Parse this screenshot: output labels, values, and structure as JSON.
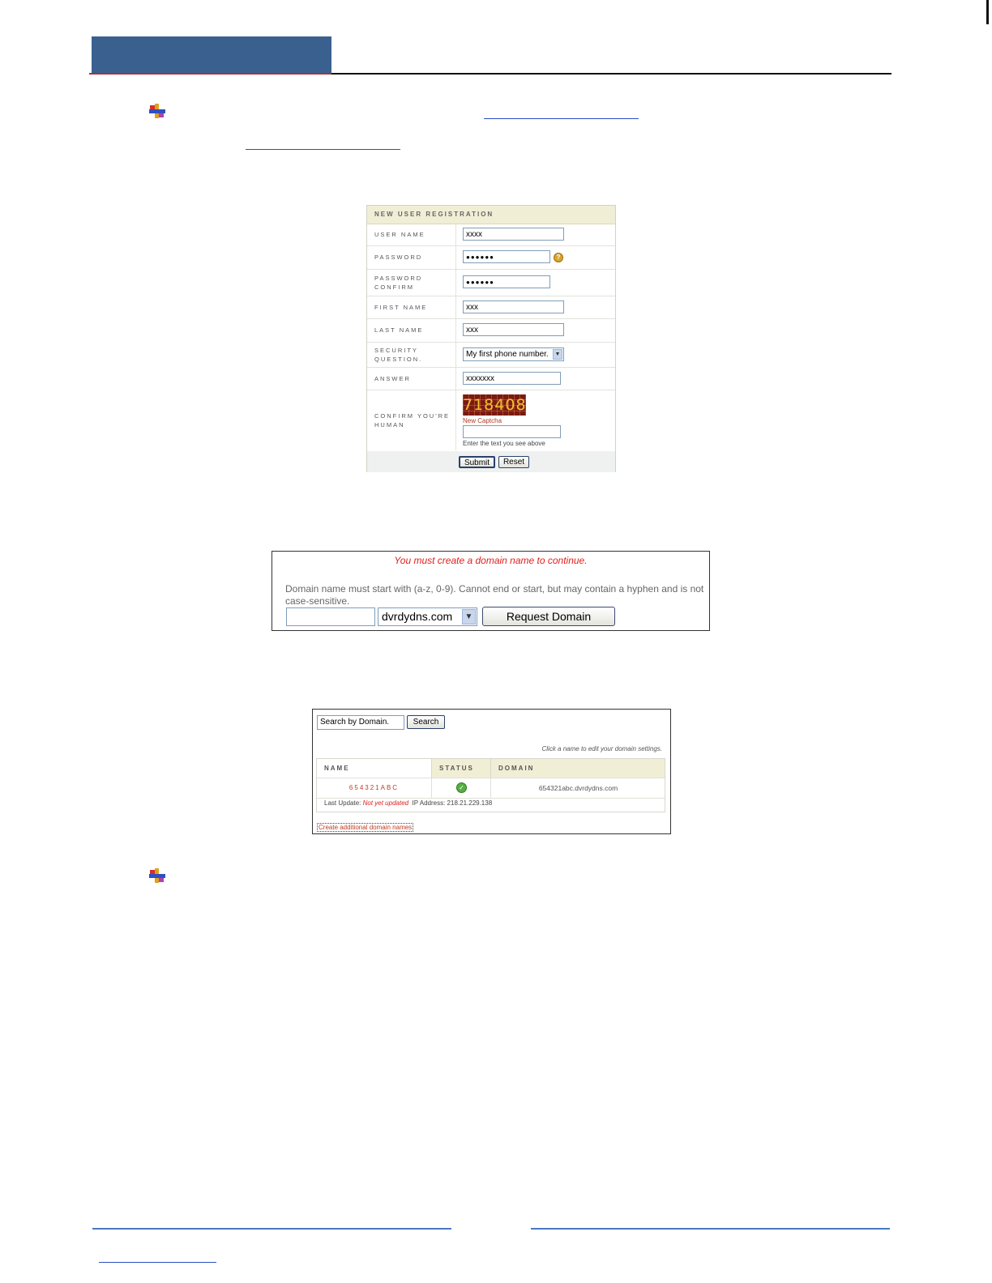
{
  "registration": {
    "title": "NEW USER REGISTRATION",
    "fields": {
      "user_name": {
        "label": "USER NAME",
        "value": "xxxx"
      },
      "password": {
        "label": "PASSWORD",
        "value": "●●●●●●"
      },
      "password_confirm": {
        "label_line1": "PASSWORD",
        "label_line2": "CONFIRM",
        "value": "●●●●●●"
      },
      "first_name": {
        "label": "FIRST NAME",
        "value": "xxx"
      },
      "last_name": {
        "label": "LAST NAME",
        "value": "xxx"
      },
      "security_question": {
        "label_line1": "SECURITY",
        "label_line2": "QUESTION.",
        "selected": "My first phone number."
      },
      "answer": {
        "label": "ANSWER",
        "value": "xxxxxxx"
      },
      "captcha": {
        "label_line1": "CONFIRM YOU'RE",
        "label_line2": "HUMAN",
        "image_text": "718408",
        "new_link": "New Captcha",
        "hint": "Enter the text you see above"
      }
    },
    "help_icon": "question-icon",
    "submit_label": "Submit",
    "reset_label": "Reset"
  },
  "domain_request": {
    "warning": "You must create a domain name to continue.",
    "rules": "Domain name must start with (a-z, 0-9). Cannot end or start, but may contain a hyphen and is not case-sensitive.",
    "input_value": "",
    "selected_domain": "dvrdydns.com",
    "button_label": "Request Domain"
  },
  "domain_list": {
    "search_value": "Search by Domain.",
    "search_button": "Search",
    "hint": "Click a name to edit your domain settings.",
    "columns": [
      "NAME",
      "STATUS",
      "DOMAIN"
    ],
    "rows": [
      {
        "name": "654321ABC",
        "status_icon": "check-icon",
        "domain": "654321abc.dvrdydns.com"
      }
    ],
    "last_update_label": "Last Update:",
    "last_update_value": "Not yet updated",
    "ip_label": "IP Address:",
    "ip_value": "218.21.229.138",
    "create_link": "Create additional domain names"
  },
  "colors": {
    "header_bar": "#3a6090",
    "warning_red": "#e0201d",
    "link_blue": "#2a4fbf",
    "form_header_bg": "#f1eed6"
  }
}
